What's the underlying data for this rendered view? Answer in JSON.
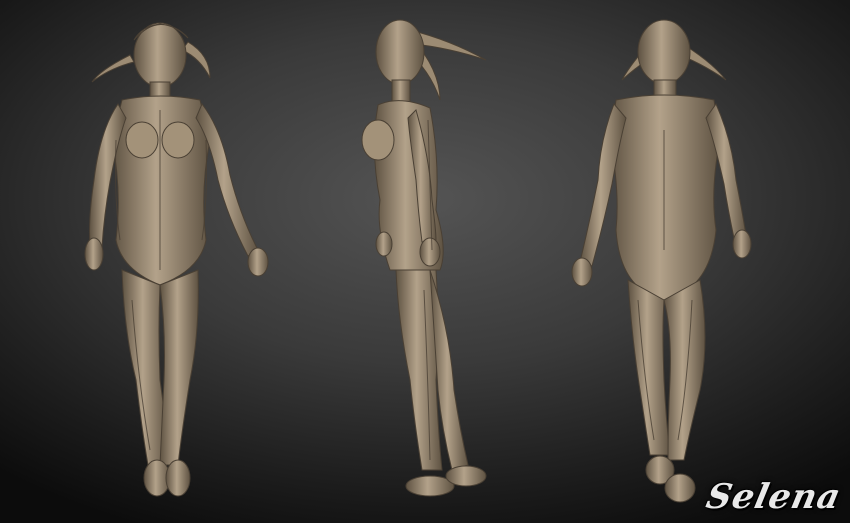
{
  "scene": {
    "background_color": "#3a3a3a",
    "skin_color": "#8a7a66",
    "skin_shadow": "#5e5242",
    "skin_highlight": "#b3a28a",
    "views": [
      "front",
      "side",
      "back"
    ]
  },
  "signature": {
    "text": "Selena"
  }
}
